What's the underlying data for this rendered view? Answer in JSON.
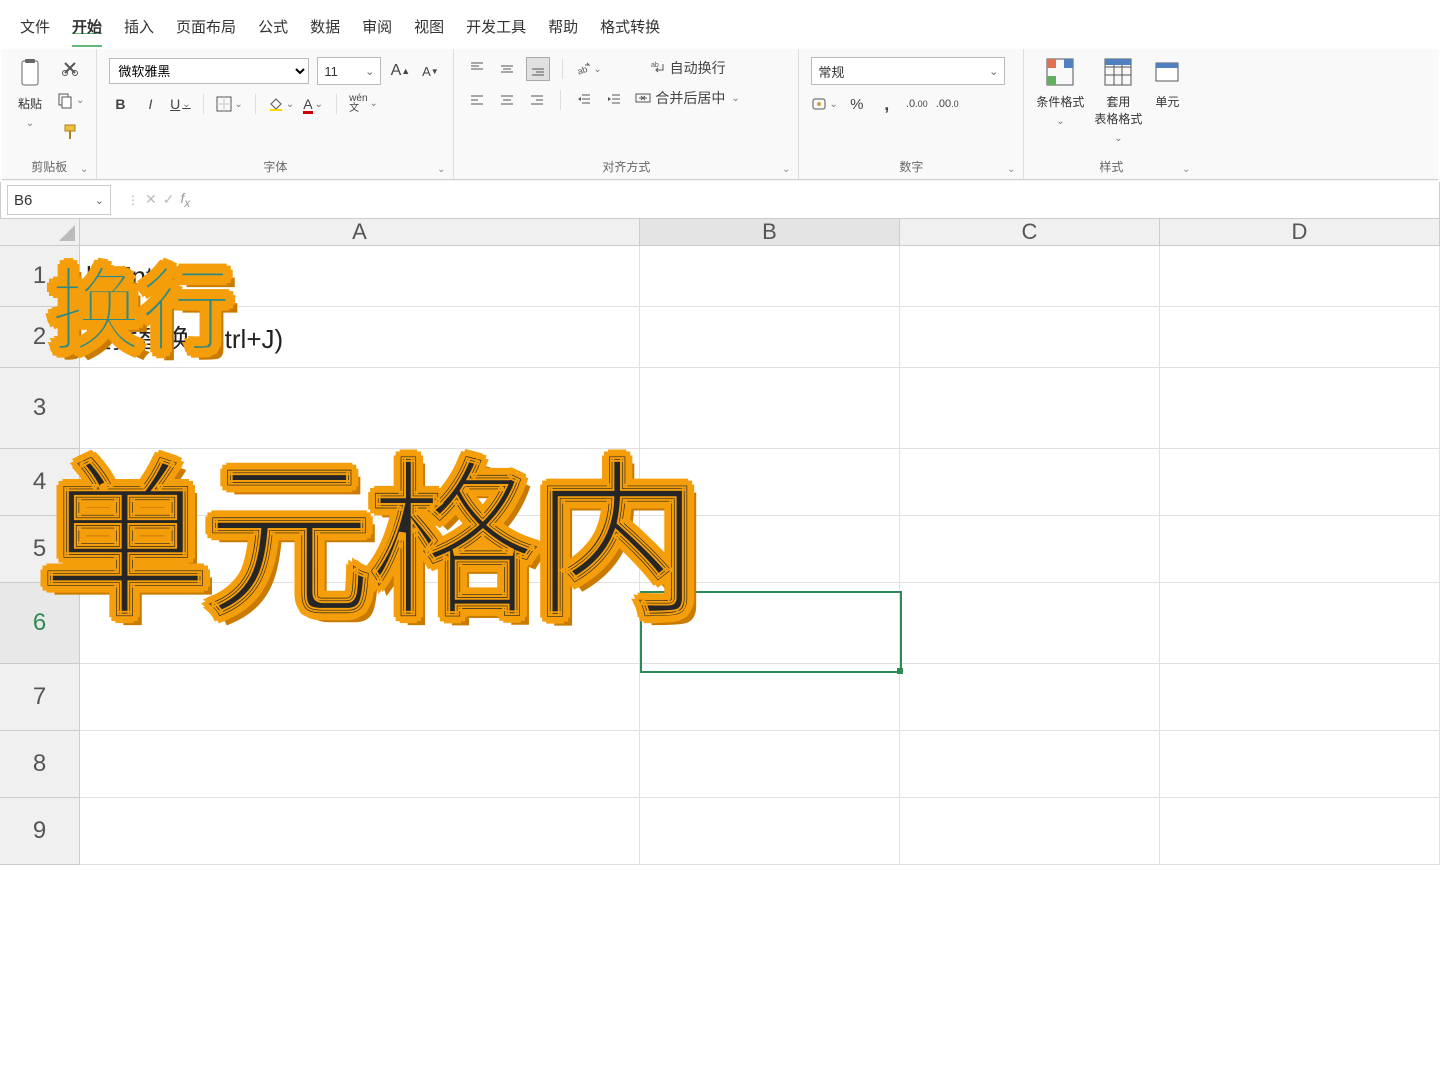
{
  "tabs": [
    "文件",
    "开始",
    "插入",
    "页面布局",
    "公式",
    "数据",
    "审阅",
    "视图",
    "开发工具",
    "帮助",
    "格式转换"
  ],
  "active_tab": 1,
  "ribbon": {
    "clipboard": {
      "paste": "粘贴",
      "label": "剪贴板"
    },
    "font": {
      "name": "微软雅黑",
      "size": "11",
      "label": "字体"
    },
    "align": {
      "wrap": "自动换行",
      "merge": "合并后居中",
      "label": "对齐方式"
    },
    "number": {
      "format": "常规",
      "label": "数字"
    },
    "style": {
      "cond": "条件格式",
      "table": "套用\n表格格式",
      "cell": "单元",
      "label": "样式"
    }
  },
  "name_box": "B6",
  "formula": "",
  "columns": [
    "A",
    "B",
    "C",
    "D"
  ],
  "rows": [
    "1",
    "2",
    "3",
    "4",
    "5",
    "6",
    "7",
    "8",
    "9"
  ],
  "row_heights": {
    "1": 60,
    "2": 60,
    "3": 80,
    "6": 80
  },
  "cells": {
    "A1": "lt+Enter",
    "A2": "查找替换 (Ctrl+J)",
    "A3": ""
  },
  "selection": {
    "col": "B",
    "row": "6"
  },
  "overlay": {
    "txt1": "换行",
    "txt2": "单元格内"
  }
}
